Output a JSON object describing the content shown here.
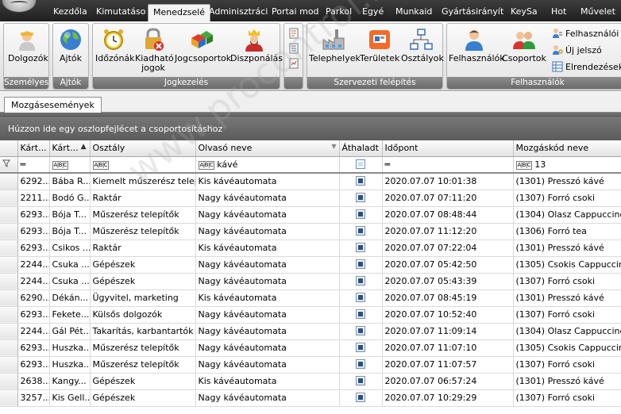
{
  "menu": {
    "tabs": [
      "Kezdőla",
      "Kimutatáso",
      "Menedzselé",
      "Adminisztráci",
      "Portai mod",
      "Parkol",
      "Egyé",
      "Munkaid",
      "Gyártásirányít",
      "KeySa",
      "Hot",
      "Művelet"
    ],
    "active_index": 2
  },
  "ribbon": {
    "groups": {
      "szemelyes": {
        "label": "Személyes",
        "buttons": [
          "Dolgozók"
        ]
      },
      "ajtok": {
        "label": "Ajtók",
        "buttons": [
          "Ajtók"
        ]
      },
      "jogkezeles": {
        "label": "Jogkezelés",
        "buttons": [
          "Időzónák",
          "Kiadható jogok",
          "Jogcsoportok",
          "Diszponálás"
        ]
      },
      "szervezeti": {
        "label": "Szervezeti felépítés",
        "buttons": [
          "Telephelyek",
          "Területek",
          "Osztályok"
        ]
      },
      "felhasznalok": {
        "label": "Felhasználók",
        "buttons": [
          "Felhasználók",
          "Csoportok"
        ],
        "small_buttons": [
          "Felhasználói te",
          "Új jelszó",
          "Elrendezések l"
        ]
      }
    }
  },
  "document_tab": "Mozgásesemények",
  "grid": {
    "group_panel_text": "Húzzon ide egy oszlopfejlécet a csoportosításhoz",
    "columns": [
      "Kárt...",
      "Kárt...",
      "Osztály",
      "Olvasó neve",
      "Áthaladt",
      "Időpont",
      "Mozgáskód neve"
    ],
    "filter_row": {
      "olvaso_neve": "kávé",
      "mozgaskod_neve": "13"
    },
    "rows": [
      {
        "k1": "6292...",
        "k2": "Bába R...",
        "osztaly": "Kiemelt műszerész telepí...",
        "olvaso": "Kis kávéautomata",
        "athaladt": true,
        "idopont": "2020.07.07 10:01:38",
        "mozgaskod": "(1301) Presszó kávé"
      },
      {
        "k1": "2211...",
        "k2": "Bodó G...",
        "osztaly": "Raktár",
        "olvaso": "Nagy kávéautomata",
        "athaladt": true,
        "idopont": "2020.07.07 07:11:20",
        "mozgaskod": "(1307) Forró csoki"
      },
      {
        "k1": "6293...",
        "k2": "Bója T...",
        "osztaly": "Műszerész telepítők",
        "olvaso": "Nagy kávéautomata",
        "athaladt": true,
        "idopont": "2020.07.07 08:48:44",
        "mozgaskod": "(1304) Olasz Cappuccino"
      },
      {
        "k1": "6293...",
        "k2": "Bója T...",
        "osztaly": "Műszerész telepítők",
        "olvaso": "Nagy kávéautomata",
        "athaladt": true,
        "idopont": "2020.07.07 11:12:20",
        "mozgaskod": "(1306) Forró tea"
      },
      {
        "k1": "6293...",
        "k2": "Csikos ...",
        "osztaly": "Raktár",
        "olvaso": "Kis kávéautomata",
        "athaladt": true,
        "idopont": "2020.07.07 07:22:04",
        "mozgaskod": "(1301) Presszó kávé"
      },
      {
        "k1": "2244...",
        "k2": "Csuka ...",
        "osztaly": "Gépészek",
        "olvaso": "Nagy kávéautomata",
        "athaladt": true,
        "idopont": "2020.07.07 05:42:50",
        "mozgaskod": "(1305) Csokis Cappuccino"
      },
      {
        "k1": "2244...",
        "k2": "Csuka ...",
        "osztaly": "Gépészek",
        "olvaso": "Nagy kávéautomata",
        "athaladt": true,
        "idopont": "2020.07.07 05:43:39",
        "mozgaskod": "(1307) Forró csoki"
      },
      {
        "k1": "6290...",
        "k2": "Dékán...",
        "osztaly": "Ügyvitel, marketing",
        "olvaso": "Kis kávéautomata",
        "athaladt": true,
        "idopont": "2020.07.07 08:45:19",
        "mozgaskod": "(1301) Presszó kávé"
      },
      {
        "k1": "6293...",
        "k2": "Fekete...",
        "osztaly": "Külsős dolgozók",
        "olvaso": "Nagy kávéautomata",
        "athaladt": true,
        "idopont": "2020.07.07 10:52:40",
        "mozgaskod": "(1307) Forró csoki"
      },
      {
        "k1": "2244...",
        "k2": "Gál Pét...",
        "osztaly": "Takarítás, karbantartók",
        "olvaso": "Nagy kávéautomata",
        "athaladt": true,
        "idopont": "2020.07.07 11:09:14",
        "mozgaskod": "(1304) Olasz Cappuccino"
      },
      {
        "k1": "6293...",
        "k2": "Huszka...",
        "osztaly": "Műszerész telepítők",
        "olvaso": "Nagy kávéautomata",
        "athaladt": true,
        "idopont": "2020.07.07 11:07:10",
        "mozgaskod": "(1305) Csokis Cappuccino"
      },
      {
        "k1": "6293...",
        "k2": "Huszka...",
        "osztaly": "Műszerész telepítők",
        "olvaso": "Nagy kávéautomata",
        "athaladt": true,
        "idopont": "2020.07.07 11:07:57",
        "mozgaskod": "(1307) Forró csoki"
      },
      {
        "k1": "2638...",
        "k2": "Kangy...",
        "osztaly": "Gépészek",
        "olvaso": "Kis kávéautomata",
        "athaladt": true,
        "idopont": "2020.07.07 06:57:24",
        "mozgaskod": "(1301) Presszó kávé"
      },
      {
        "k1": "3257...",
        "k2": "Kis Gell...",
        "osztaly": "Gépészek",
        "olvaso": "Nagy kávéautomata",
        "athaladt": true,
        "idopont": "2020.07.07 10:29:29",
        "mozgaskod": "(1307) Forró csoki"
      }
    ]
  },
  "watermark": "www.procontrol.hu",
  "colors": {
    "menubar": "#2e2e2e",
    "ribbon_label": "#767676",
    "grid_header_panel": "#666666",
    "checkbox_fill": "#2a4f8a"
  }
}
